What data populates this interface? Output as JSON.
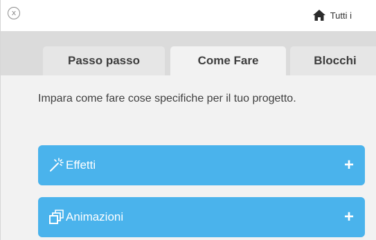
{
  "topbar": {
    "close_glyph": "x",
    "close_icon": "close-circle-icon",
    "home_icon": "home-icon",
    "home_label": "Tutti i"
  },
  "tabs": [
    {
      "label": "Passo passo",
      "active": false
    },
    {
      "label": "Come Fare",
      "active": true
    },
    {
      "label": "Blocchi",
      "active": false
    }
  ],
  "content": {
    "intro": "Impara come fare cose specifiche per il tuo progetto.",
    "sections": [
      {
        "label": "Effetti",
        "icon": "magic-wand-icon",
        "expand_glyph": "+"
      },
      {
        "label": "Animazioni",
        "icon": "layers-icon",
        "expand_glyph": "+"
      }
    ]
  },
  "colors": {
    "accent": "#4ab3ec",
    "tab_strip": "#dbdbdb",
    "content_bg": "#f2f2f2",
    "text": "#404040"
  }
}
